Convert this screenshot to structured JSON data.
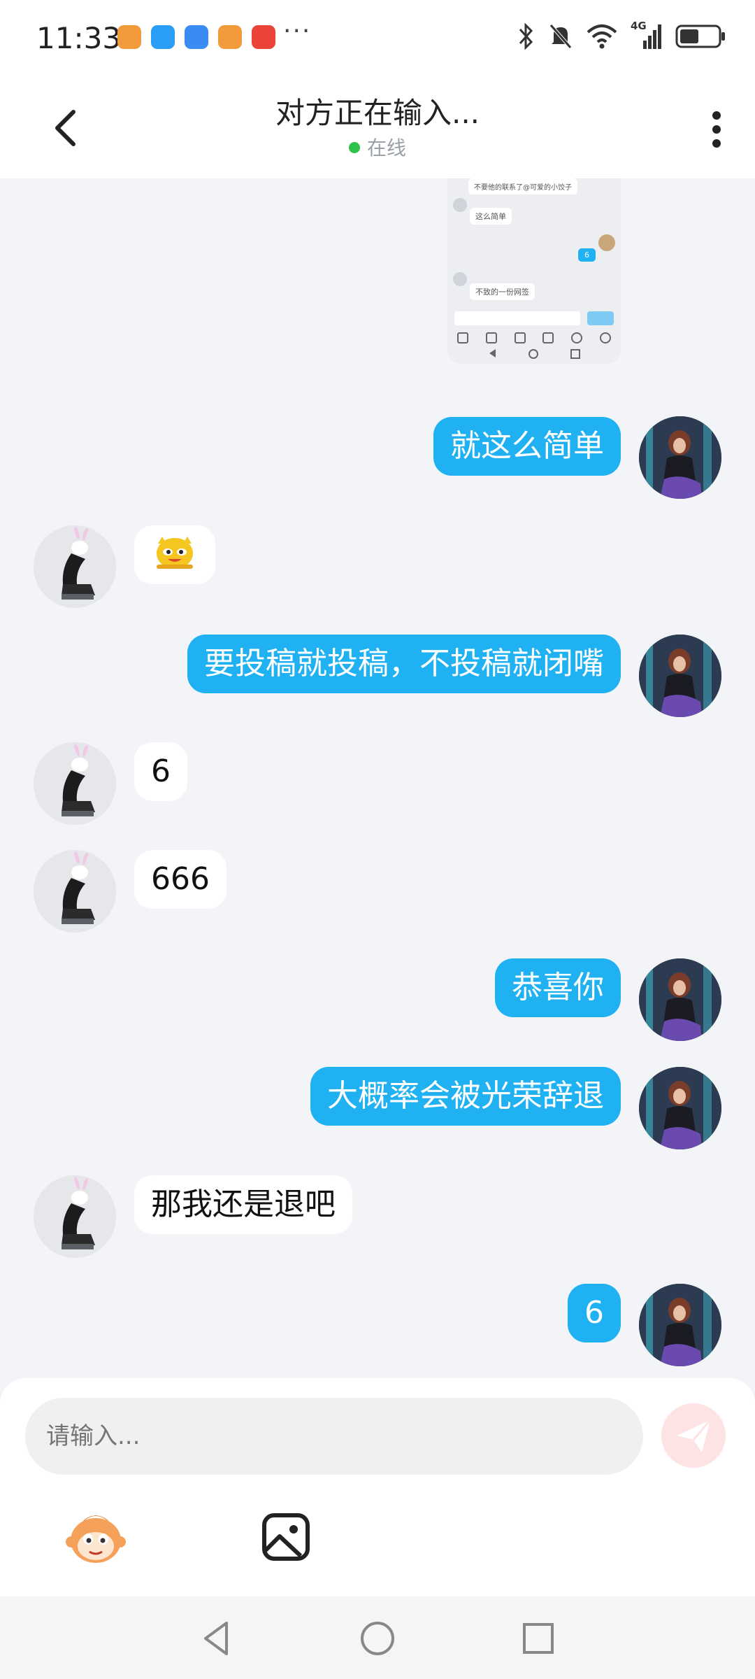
{
  "status_bar": {
    "time": "11:33",
    "more": "···",
    "network": "4G",
    "app_icons": [
      {
        "name": "app-orange-icon",
        "color": "#f39a3c"
      },
      {
        "name": "app-blue-chat-icon",
        "color": "#2a9df4"
      },
      {
        "name": "app-weather-icon",
        "color": "#3a8cf3"
      },
      {
        "name": "app-orange-2-icon",
        "color": "#f39a3c"
      },
      {
        "name": "taobao-icon",
        "color": "#e9433a"
      }
    ]
  },
  "header": {
    "title": "对方正在输入...",
    "status": "在线"
  },
  "screenshot_preview": {
    "lines": [
      "不要他的联系了@可爱的小饺子",
      "这么简单",
      "6",
      "不致的一份网签"
    ]
  },
  "messages": [
    {
      "side": "me",
      "text": "就这么简单"
    },
    {
      "side": "other",
      "text": "",
      "sticker": "smiling-face-sticker"
    },
    {
      "side": "me",
      "text": "要投稿就投稿，不投稿就闭嘴"
    },
    {
      "side": "other",
      "text": "6"
    },
    {
      "side": "other",
      "text": "666"
    },
    {
      "side": "me",
      "text": "恭喜你"
    },
    {
      "side": "me",
      "text": "大概率会被光荣辞退"
    },
    {
      "side": "other",
      "text": "那我还是退吧"
    },
    {
      "side": "me",
      "text": "6"
    }
  ],
  "input": {
    "placeholder": "请输入..."
  },
  "colors": {
    "my_bubble": "#1fb1f2",
    "their_bubble": "#ffffff",
    "online_dot": "#2dc24a",
    "send_button": "#fde3e3"
  }
}
